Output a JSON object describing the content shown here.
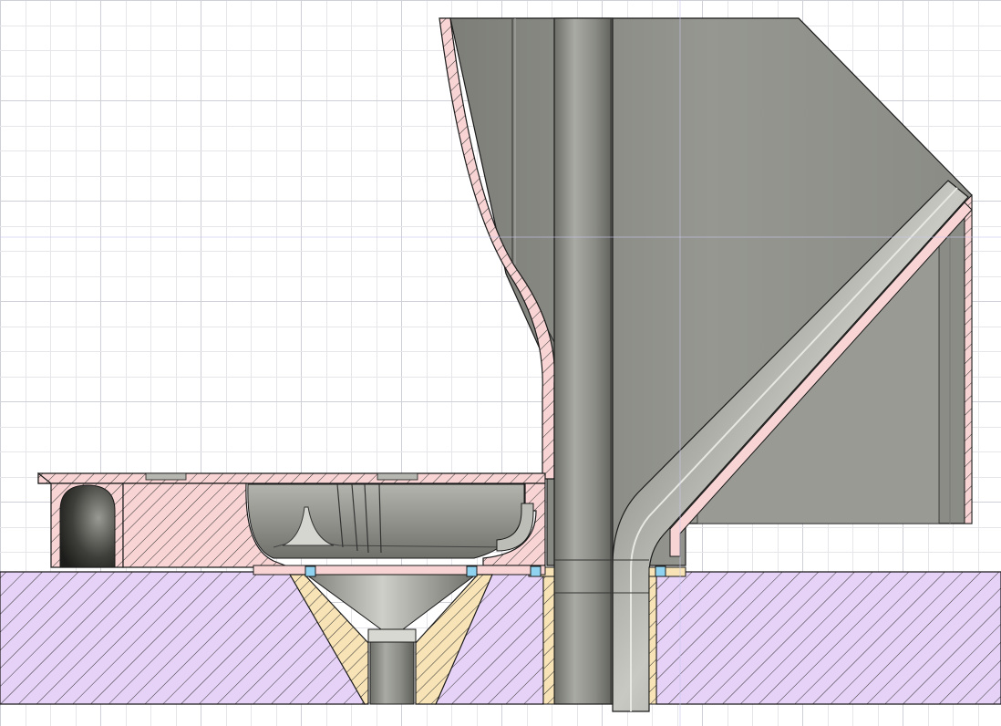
{
  "view": {
    "kind": "cad-section-view",
    "background_color": "#ffffff",
    "grid_minor_color": "#e6e6ea",
    "grid_major_color": "#cfcfd8"
  },
  "materials": {
    "base_plate_fill": "#e6d2f7",
    "housing_fill": "#f8d4d4",
    "insert_fill": "#f7e3b6",
    "steel_gray": "#8f908a",
    "outline": "#1a1a1a",
    "marker_fill": "#8fd3f0"
  },
  "parts": [
    {
      "name": "base-plate",
      "material": "base_plate_fill"
    },
    {
      "name": "pump-housing",
      "material": "housing_fill"
    },
    {
      "name": "cone-insert",
      "material": "insert_fill"
    },
    {
      "name": "sleeve-insert",
      "material": "insert_fill"
    },
    {
      "name": "hopper",
      "material": "steel_gray"
    },
    {
      "name": "central-shaft",
      "material": "steel_gray"
    },
    {
      "name": "diagonal-pipe",
      "material": "steel_gray"
    },
    {
      "name": "impeller",
      "material": "steel_gray"
    }
  ]
}
